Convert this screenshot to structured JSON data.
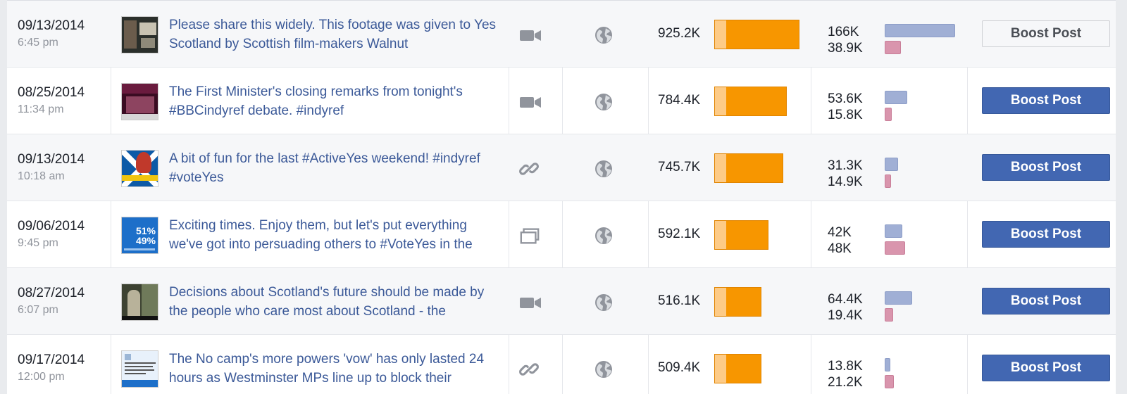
{
  "posts": [
    {
      "date": "09/13/2014",
      "time": "6:45 pm",
      "text": "Please share this widely. This footage was given to Yes Scotland by Scottish film-makers Walnut",
      "type_icon": "video-icon",
      "thumb": "dark-footage",
      "reach": "925.2K",
      "reach_value": 925.2,
      "eng1": "166K",
      "eng1_value": 166,
      "eng2": "38.9K",
      "eng2_value": 38.9,
      "boost_label": "Boost Post",
      "boost_style": "white"
    },
    {
      "date": "08/25/2014",
      "time": "11:34 pm",
      "text": "The First Minister's closing remarks from tonight's #BBCindyref debate. #indyref",
      "type_icon": "video-icon",
      "thumb": "debate",
      "reach": "784.4K",
      "reach_value": 784.4,
      "eng1": "53.6K",
      "eng1_value": 53.6,
      "eng2": "15.8K",
      "eng2_value": 15.8,
      "boost_label": "Boost Post",
      "boost_style": "blue"
    },
    {
      "date": "09/13/2014",
      "time": "10:18 am",
      "text": "A bit of fun for the last #ActiveYes weekend! #indyref #voteYes",
      "type_icon": "link-icon",
      "thumb": "saltire",
      "reach": "745.7K",
      "reach_value": 745.7,
      "eng1": "31.3K",
      "eng1_value": 31.3,
      "eng2": "14.9K",
      "eng2_value": 14.9,
      "boost_label": "Boost Post",
      "boost_style": "blue"
    },
    {
      "date": "09/06/2014",
      "time": "9:45 pm",
      "text": "Exciting times. Enjoy them, but let's put everything we've got into persuading others to #VoteYes in the",
      "type_icon": "photo-icon",
      "thumb": "poll",
      "thumb_line1": "51%",
      "thumb_line2": "49%",
      "reach": "592.1K",
      "reach_value": 592.1,
      "eng1": "42K",
      "eng1_value": 42,
      "eng2": "48K",
      "eng2_value": 48,
      "boost_label": "Boost Post",
      "boost_style": "blue"
    },
    {
      "date": "08/27/2014",
      "time": "6:07 pm",
      "text": "Decisions about Scotland's future should be made by the people who care most about Scotland - the",
      "type_icon": "video-icon",
      "thumb": "person",
      "reach": "516.1K",
      "reach_value": 516.1,
      "eng1": "64.4K",
      "eng1_value": 64.4,
      "eng2": "19.4K",
      "eng2_value": 19.4,
      "boost_label": "Boost Post",
      "boost_style": "blue"
    },
    {
      "date": "09/17/2014",
      "time": "12:00 pm",
      "text": "The No camp's more powers 'vow' has only lasted 24 hours as Westminster MPs line up to block their",
      "type_icon": "link-icon",
      "thumb": "tweet",
      "reach": "509.4K",
      "reach_value": 509.4,
      "eng1": "13.8K",
      "eng1_value": 13.8,
      "eng2": "21.2K",
      "eng2_value": 21.2,
      "boost_label": "Boost Post",
      "boost_style": "blue"
    }
  ],
  "audience_icon": "globe-icon",
  "colors": {
    "reach_paid": "#f79600",
    "reach_organic": "#fdcb87",
    "engagement_clicks": "#a0afd5",
    "engagement_reactions": "#d995ad",
    "boost_blue": "#4267b2",
    "link": "#3b5998"
  }
}
